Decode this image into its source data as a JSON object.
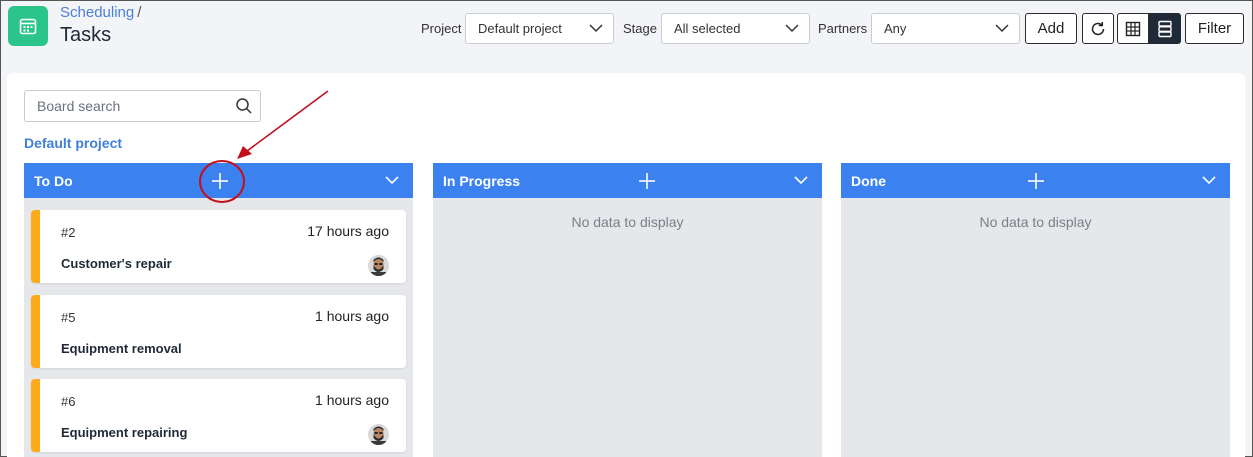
{
  "header": {
    "breadcrumb": "Scheduling",
    "breadcrumb_sep": "/",
    "title": "Tasks",
    "app_icon": "calendar-icon"
  },
  "filters": {
    "project_label": "Project",
    "project_value": "Default project",
    "stage_label": "Stage",
    "stage_value": "All selected",
    "partners_label": "Partners",
    "partners_value": "Any"
  },
  "toolbar": {
    "add_label": "Add",
    "refresh_icon": "refresh-icon",
    "grid_icon": "grid-view-icon",
    "board_icon": "board-view-icon",
    "filter_label": "Filter"
  },
  "board": {
    "search_placeholder": "Board search",
    "project_name": "Default project",
    "columns": [
      {
        "title": "To Do",
        "empty_text": "",
        "cards": [
          {
            "number": "#2",
            "time": "17 hours ago",
            "title": "Customer's repair",
            "has_avatar": true
          },
          {
            "number": "#5",
            "time": "1 hours ago",
            "title": "Equipment removal",
            "has_avatar": false
          },
          {
            "number": "#6",
            "time": "1 hours ago",
            "title": "Equipment repairing",
            "has_avatar": true
          }
        ]
      },
      {
        "title": "In Progress",
        "empty_text": "No data to display",
        "cards": []
      },
      {
        "title": "Done",
        "empty_text": "No data to display",
        "cards": []
      }
    ]
  },
  "colors": {
    "accent": "#3b82f0",
    "card_stripe": "#ffaa1a",
    "app_icon_bg": "#2bc48a",
    "annotation": "#c4101d"
  }
}
